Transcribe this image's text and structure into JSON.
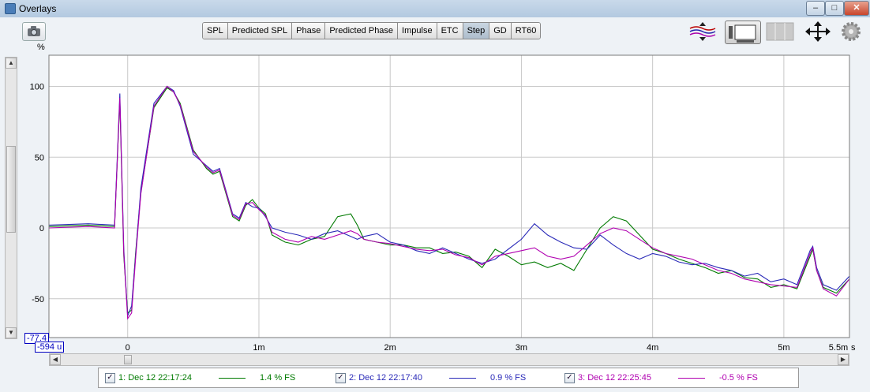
{
  "window": {
    "title": "Overlays",
    "minimize": "–",
    "maximize": "□",
    "close": "✕"
  },
  "tabs": [
    {
      "label": "SPL"
    },
    {
      "label": "Predicted SPL"
    },
    {
      "label": "Phase"
    },
    {
      "label": "Predicted Phase"
    },
    {
      "label": "Impulse"
    },
    {
      "label": "ETC"
    },
    {
      "label": "Step",
      "active": true
    },
    {
      "label": "GD"
    },
    {
      "label": "RT60"
    }
  ],
  "toolbar_icons": [
    "camera-icon",
    "vertical-zoom-icon",
    "controls-icon",
    "grid-panels-icon",
    "pan-arrows-icon",
    "gear-icon"
  ],
  "cursor": {
    "y_value": "-77.4",
    "x_value": "-594 u"
  },
  "legend": [
    {
      "label": "1: Dec 12 22:17:24",
      "value": "1.4 % FS",
      "color": "#007a00",
      "checked": "✓"
    },
    {
      "label": "2: Dec 12 22:17:40",
      "value": "0.9 % FS",
      "color": "#2a2ab8",
      "checked": "✓"
    },
    {
      "label": "3: Dec 12 22:25:45",
      "value": "-0.5 % FS",
      "color": "#b000b0",
      "checked": "✓"
    }
  ],
  "chart_data": {
    "type": "line",
    "ylabel": "%",
    "xlabel": "",
    "x_unit_label": "s",
    "xlim": [
      -0.6,
      5.5
    ],
    "ylim": [
      -77.4,
      122
    ],
    "y_ticks": [
      {
        "value": 100,
        "label": "100"
      },
      {
        "value": 50,
        "label": "50"
      },
      {
        "value": 0,
        "label": "0"
      },
      {
        "value": -50,
        "label": "-50"
      }
    ],
    "x_ticks": [
      {
        "value": 0,
        "label": "0"
      },
      {
        "value": 1,
        "label": "1m"
      },
      {
        "value": 2,
        "label": "2m"
      },
      {
        "value": 3,
        "label": "3m"
      },
      {
        "value": 4,
        "label": "4m"
      },
      {
        "value": 5,
        "label": "5m"
      },
      {
        "value": 5.5,
        "label": "5.5m"
      }
    ],
    "grid": true,
    "series": [
      {
        "name": "1: Dec 12 22:17:24",
        "color": "#007a00",
        "x": [
          -0.6,
          -0.3,
          -0.1,
          -0.06,
          -0.03,
          0.0,
          0.03,
          0.06,
          0.1,
          0.2,
          0.3,
          0.35,
          0.4,
          0.5,
          0.6,
          0.65,
          0.7,
          0.8,
          0.85,
          0.9,
          0.95,
          1.0,
          1.05,
          1.1,
          1.2,
          1.3,
          1.4,
          1.5,
          1.6,
          1.7,
          1.75,
          1.8,
          1.9,
          2.0,
          2.1,
          2.2,
          2.3,
          2.4,
          2.5,
          2.6,
          2.7,
          2.8,
          2.9,
          3.0,
          3.1,
          3.2,
          3.3,
          3.4,
          3.5,
          3.6,
          3.7,
          3.8,
          3.9,
          4.0,
          4.1,
          4.2,
          4.3,
          4.4,
          4.5,
          4.6,
          4.7,
          4.8,
          4.9,
          5.0,
          5.1,
          5.2,
          5.22,
          5.25,
          5.3,
          5.4,
          5.5
        ],
        "y": [
          1,
          2,
          1,
          90,
          -20,
          -60,
          -58,
          -18,
          25,
          85,
          99,
          96,
          88,
          55,
          42,
          38,
          40,
          8,
          5,
          16,
          20,
          14,
          10,
          -5,
          -10,
          -12,
          -8,
          -6,
          8,
          10,
          2,
          -8,
          -10,
          -12,
          -12,
          -14,
          -14,
          -18,
          -17,
          -20,
          -28,
          -15,
          -20,
          -26,
          -24,
          -28,
          -25,
          -30,
          -15,
          0,
          8,
          5,
          -5,
          -15,
          -18,
          -22,
          -25,
          -28,
          -32,
          -30,
          -35,
          -36,
          -42,
          -40,
          -43,
          -20,
          -15,
          -30,
          -42,
          -46,
          -36
        ]
      },
      {
        "name": "2: Dec 12 22:17:40",
        "color": "#2a2ab8",
        "x": [
          -0.6,
          -0.3,
          -0.1,
          -0.06,
          -0.03,
          0.0,
          0.03,
          0.06,
          0.1,
          0.2,
          0.3,
          0.35,
          0.4,
          0.5,
          0.6,
          0.65,
          0.7,
          0.8,
          0.85,
          0.9,
          0.95,
          1.0,
          1.05,
          1.1,
          1.2,
          1.3,
          1.4,
          1.5,
          1.6,
          1.7,
          1.75,
          1.8,
          1.9,
          2.0,
          2.1,
          2.2,
          2.3,
          2.4,
          2.5,
          2.6,
          2.7,
          2.8,
          2.9,
          3.0,
          3.1,
          3.2,
          3.3,
          3.4,
          3.5,
          3.6,
          3.7,
          3.8,
          3.9,
          4.0,
          4.1,
          4.2,
          4.3,
          4.4,
          4.5,
          4.6,
          4.7,
          4.8,
          4.9,
          5.0,
          5.1,
          5.2,
          5.22,
          5.25,
          5.3,
          5.4,
          5.5
        ],
        "y": [
          2,
          3,
          2,
          95,
          -15,
          -62,
          -55,
          -20,
          28,
          88,
          100,
          97,
          86,
          52,
          44,
          40,
          42,
          10,
          7,
          18,
          15,
          14,
          8,
          0,
          -3,
          -5,
          -8,
          -4,
          -2,
          -6,
          -8,
          -6,
          -4,
          -10,
          -12,
          -16,
          -18,
          -14,
          -18,
          -22,
          -25,
          -22,
          -15,
          -8,
          3,
          -5,
          -10,
          -14,
          -15,
          -5,
          -12,
          -18,
          -22,
          -18,
          -20,
          -24,
          -26,
          -25,
          -28,
          -30,
          -34,
          -32,
          -38,
          -36,
          -40,
          -16,
          -13,
          -28,
          -40,
          -44,
          -34
        ]
      },
      {
        "name": "3: Dec 12 22:25:45",
        "color": "#b000b0",
        "x": [
          -0.6,
          -0.3,
          -0.1,
          -0.06,
          -0.03,
          0.0,
          0.03,
          0.06,
          0.1,
          0.2,
          0.3,
          0.35,
          0.4,
          0.5,
          0.6,
          0.65,
          0.7,
          0.8,
          0.85,
          0.9,
          0.95,
          1.0,
          1.05,
          1.1,
          1.2,
          1.3,
          1.4,
          1.5,
          1.6,
          1.7,
          1.75,
          1.8,
          1.9,
          2.0,
          2.1,
          2.2,
          2.3,
          2.4,
          2.5,
          2.6,
          2.7,
          2.8,
          2.9,
          3.0,
          3.1,
          3.2,
          3.3,
          3.4,
          3.5,
          3.6,
          3.7,
          3.8,
          3.9,
          4.0,
          4.1,
          4.2,
          4.3,
          4.4,
          4.5,
          4.6,
          4.7,
          4.8,
          4.9,
          5.0,
          5.1,
          5.2,
          5.22,
          5.25,
          5.3,
          5.4,
          5.5
        ],
        "y": [
          0,
          1,
          0,
          92,
          -18,
          -64,
          -60,
          -22,
          24,
          86,
          100,
          96,
          87,
          54,
          43,
          39,
          41,
          9,
          6,
          17,
          18,
          13,
          9,
          -3,
          -8,
          -10,
          -6,
          -8,
          -5,
          -2,
          -4,
          -8,
          -10,
          -11,
          -13,
          -15,
          -16,
          -15,
          -19,
          -21,
          -26,
          -20,
          -18,
          -16,
          -14,
          -20,
          -22,
          -20,
          -12,
          -4,
          0,
          -2,
          -8,
          -14,
          -18,
          -20,
          -22,
          -26,
          -30,
          -32,
          -36,
          -38,
          -40,
          -41,
          -42,
          -18,
          -14,
          -30,
          -43,
          -48,
          -36
        ]
      }
    ]
  }
}
